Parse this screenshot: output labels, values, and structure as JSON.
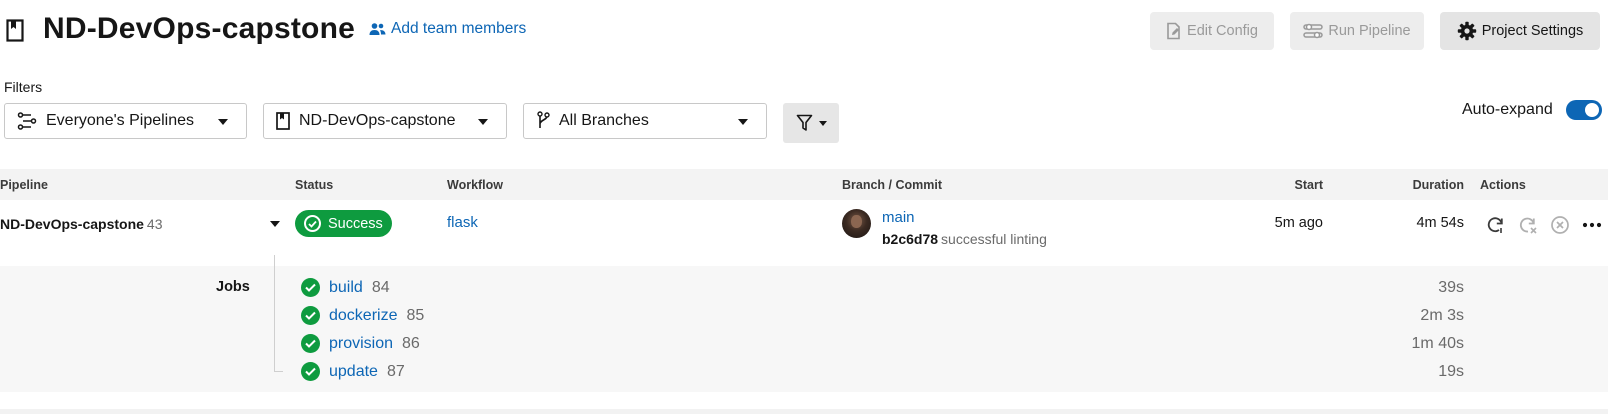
{
  "header": {
    "title": "ND-DevOps-capstone",
    "add_team_label": "Add team members",
    "edit_config_label": "Edit Config",
    "run_pipeline_label": "Run Pipeline",
    "project_settings_label": "Project Settings"
  },
  "filters": {
    "label": "Filters",
    "pipelines_selected": "Everyone's Pipelines",
    "project_selected": "ND-DevOps-capstone",
    "branch_selected": "All Branches",
    "auto_expand_label": "Auto-expand",
    "auto_expand_on": true
  },
  "table": {
    "columns": {
      "pipeline": "Pipeline",
      "status": "Status",
      "workflow": "Workflow",
      "branch_commit": "Branch / Commit",
      "start": "Start",
      "duration": "Duration",
      "actions": "Actions"
    },
    "row": {
      "pipeline_name": "ND-DevOps-capstone",
      "pipeline_number": "43",
      "status": "Success",
      "workflow": "flask",
      "branch": "main",
      "commit_hash": "b2c6d78",
      "commit_message": "successful linting",
      "start": "5m ago",
      "duration": "4m 54s"
    }
  },
  "jobs": {
    "label": "Jobs",
    "items": [
      {
        "name": "build",
        "number": "84",
        "duration": "39s"
      },
      {
        "name": "dockerize",
        "number": "85",
        "duration": "2m 3s"
      },
      {
        "name": "provision",
        "number": "86",
        "duration": "1m 40s"
      },
      {
        "name": "update",
        "number": "87",
        "duration": "19s"
      }
    ]
  },
  "colors": {
    "accent": "#0d66b5",
    "success": "#0e9b3f",
    "button_bg": "#ededed"
  },
  "icons": {
    "project": "bookmark-icon",
    "team": "people-icon",
    "edit_config": "file-edit-icon",
    "run_pipeline": "sliders-icon",
    "settings": "gear-icon",
    "pipelines_filter": "pipelines-icon",
    "branch": "git-branch-icon",
    "filter": "funnel-icon",
    "rerun": "rerun-icon",
    "rerun_failed": "rerun-failed-icon",
    "cancel": "cancel-icon",
    "more": "more-icon"
  }
}
